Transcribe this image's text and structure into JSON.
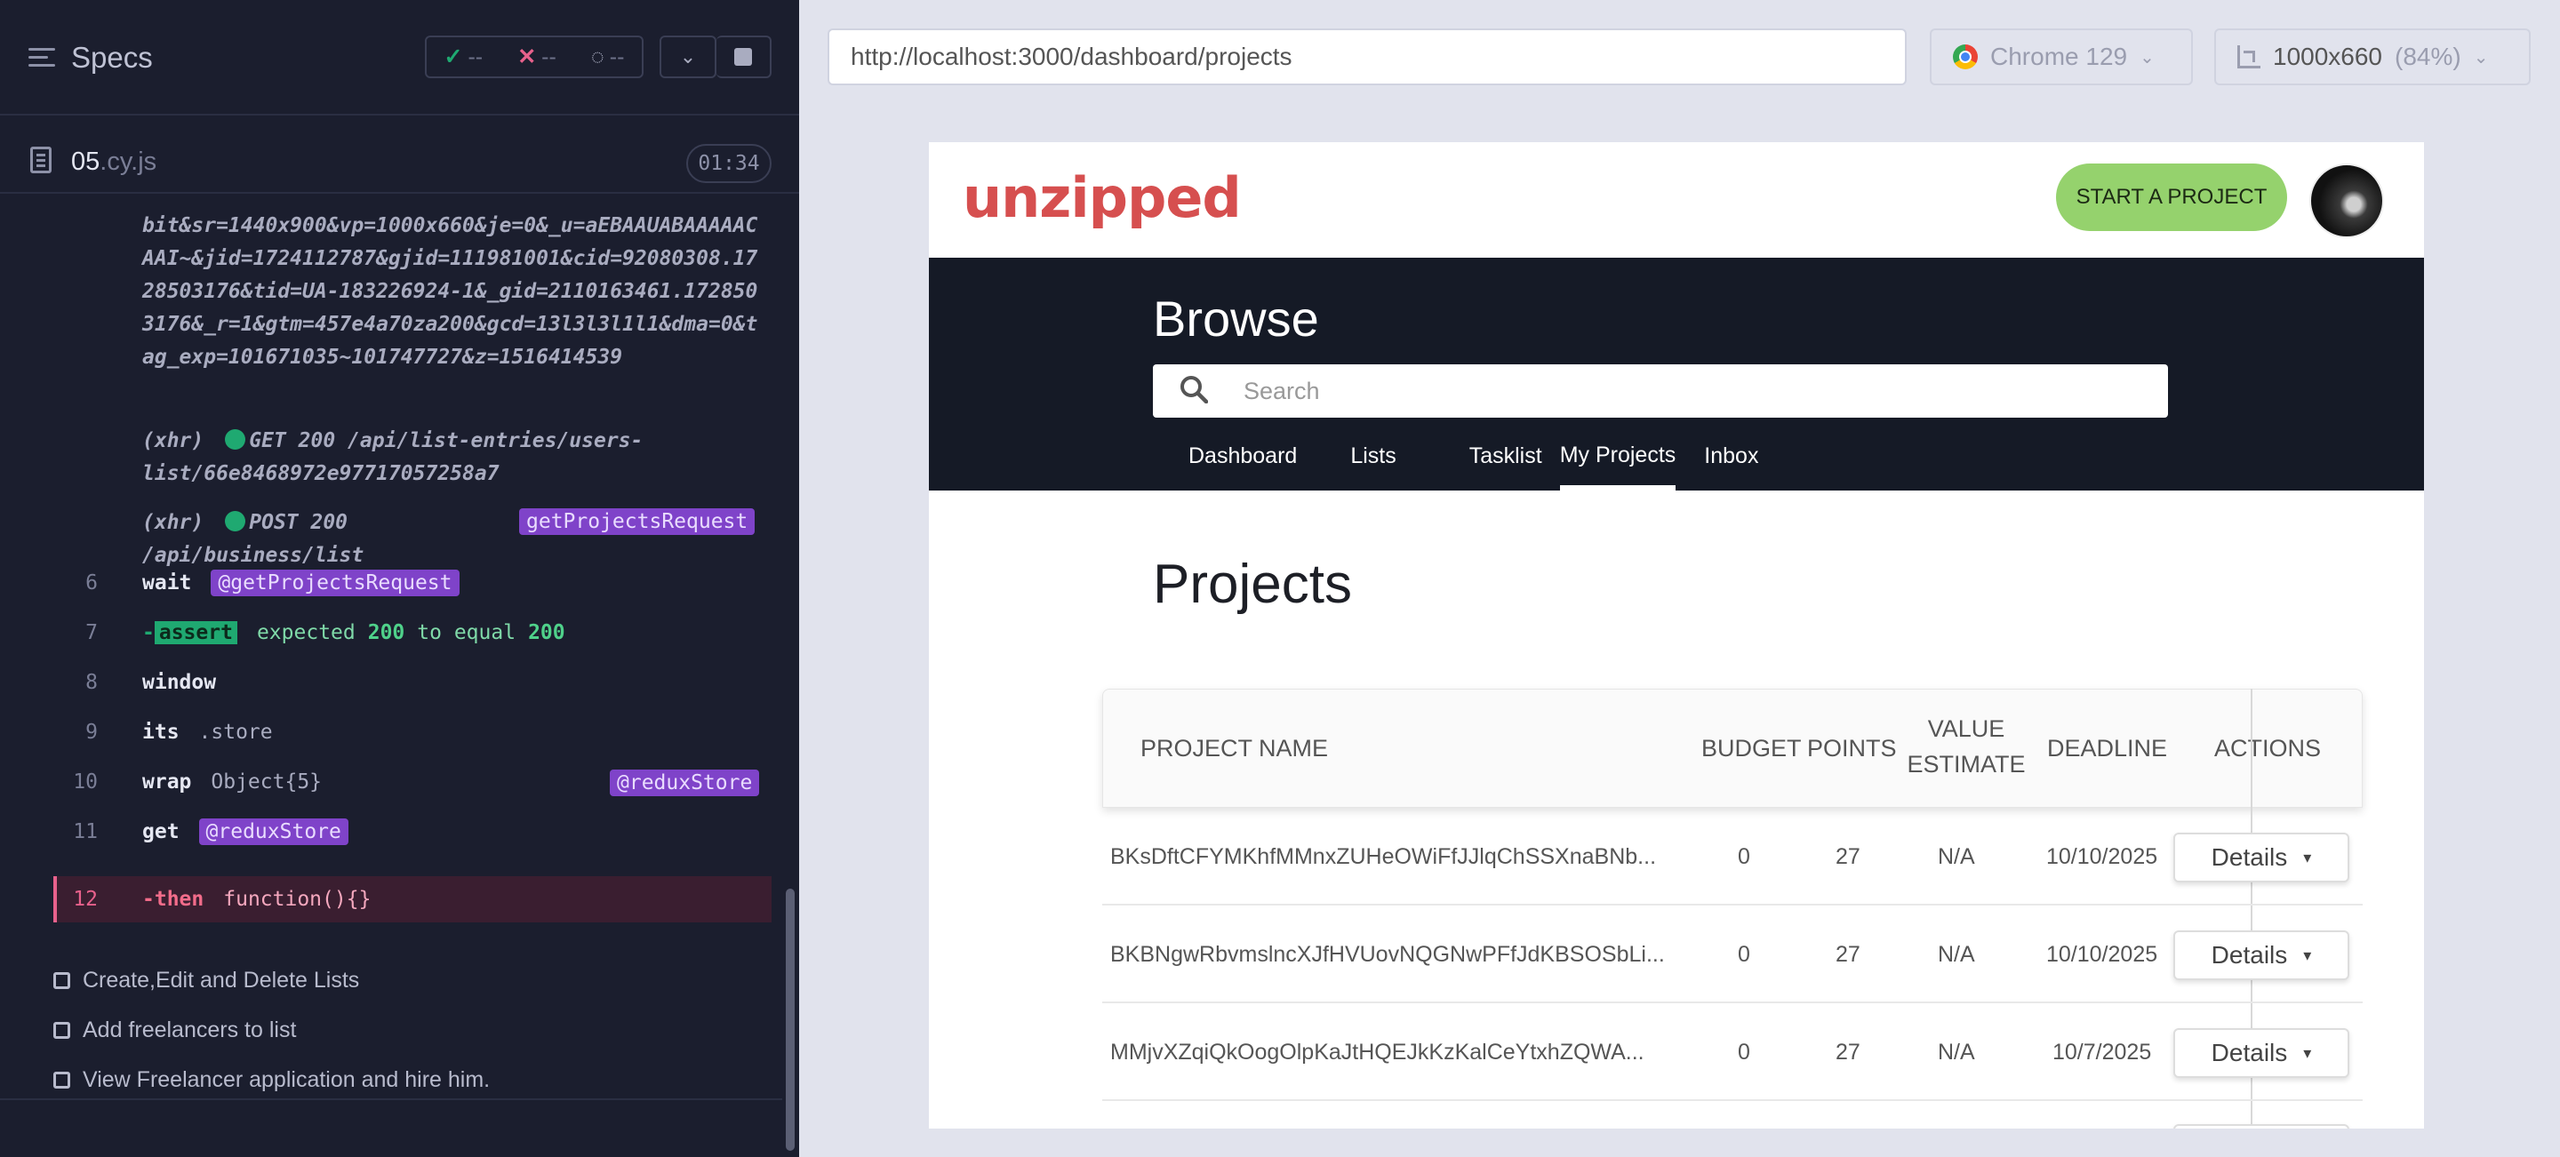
{
  "runner": {
    "specs_label": "Specs",
    "stats": {
      "passed": "--",
      "failed": "--",
      "pending": "--"
    },
    "file": {
      "name": "05",
      "ext": ".cy.js",
      "duration": "01:34"
    },
    "log": {
      "url_text": "bit&sr=1440x900&vp=1000x660&je=0&_u=aEBAAUABAAAAACAAI~&jid=1724112787&gjid=111981001&cid=92080308.1728503176&tid=UA-183226924-1&_gid=2110163461.1728503176&_r=1&gtm=457e4a70za200&gcd=13l3l3l1l1&dma=0&tag_exp=101671035~101747727&z=1516414539",
      "xhr1": {
        "type": "(xhr)",
        "method": "GET 200",
        "path": "/api/list-entries/users-",
        "path2": "list/66e8468972e97717057258a7"
      },
      "xhr2": {
        "type": "(xhr)",
        "method": "POST 200",
        "path": "/api/business/list",
        "alias": "getProjectsRequest"
      },
      "commands": [
        {
          "num": "6",
          "name": "wait",
          "arg": "@getProjectsRequest"
        },
        {
          "num": "7",
          "name": "-assert",
          "msg": [
            "expected",
            "200",
            "to equal",
            "200"
          ]
        },
        {
          "num": "8",
          "name": "window"
        },
        {
          "num": "9",
          "name": "its",
          "msg": ".store"
        },
        {
          "num": "10",
          "name": "wrap",
          "msg": "Object{5}",
          "alias": "@reduxStore"
        },
        {
          "num": "11",
          "name": "get",
          "arg": "@reduxStore"
        },
        {
          "num": "12",
          "name": "-then",
          "msg": "function(){}"
        }
      ]
    },
    "tests": [
      "Create,Edit and Delete Lists",
      "Add freelancers to list",
      "View Freelancer application and hire him."
    ]
  },
  "browser": {
    "url": "http://localhost:3000/dashboard/projects",
    "name": "Chrome 129",
    "viewport": "1000x660",
    "zoom": "(84%)"
  },
  "app": {
    "logo": "unzipped",
    "start_btn": "START A PROJECT",
    "browse_title": "Browse",
    "search_placeholder": "Search",
    "nav": [
      "Dashboard",
      "Lists",
      "Tasklist",
      "My Projects",
      "Inbox"
    ],
    "active_nav": "My Projects",
    "projects_title": "Projects",
    "columns": [
      "PROJECT NAME",
      "BUDGET",
      "POINTS",
      "VALUE",
      "ESTIMATE",
      "DEADLINE",
      "ACTIONS"
    ],
    "rows": [
      {
        "name": "BKsDftCFYMKhfMMnxZUHeOWiFfJJlqChSSXnaBNb...",
        "budget": "0",
        "points": "27",
        "value": "N/A",
        "deadline": "10/10/2025",
        "action": "Details"
      },
      {
        "name": "BKBNgwRbvmslncXJfHVUovNQGNwPFfJdKBSOSbLi...",
        "budget": "0",
        "points": "27",
        "value": "N/A",
        "deadline": "10/10/2025",
        "action": "Details"
      },
      {
        "name": "MMjvXZqiQkOogOlpKaJtHQEJkKzKalCeYtxhZQWA...",
        "budget": "0",
        "points": "27",
        "value": "N/A",
        "deadline": "10/7/2025",
        "action": "Details"
      }
    ]
  }
}
